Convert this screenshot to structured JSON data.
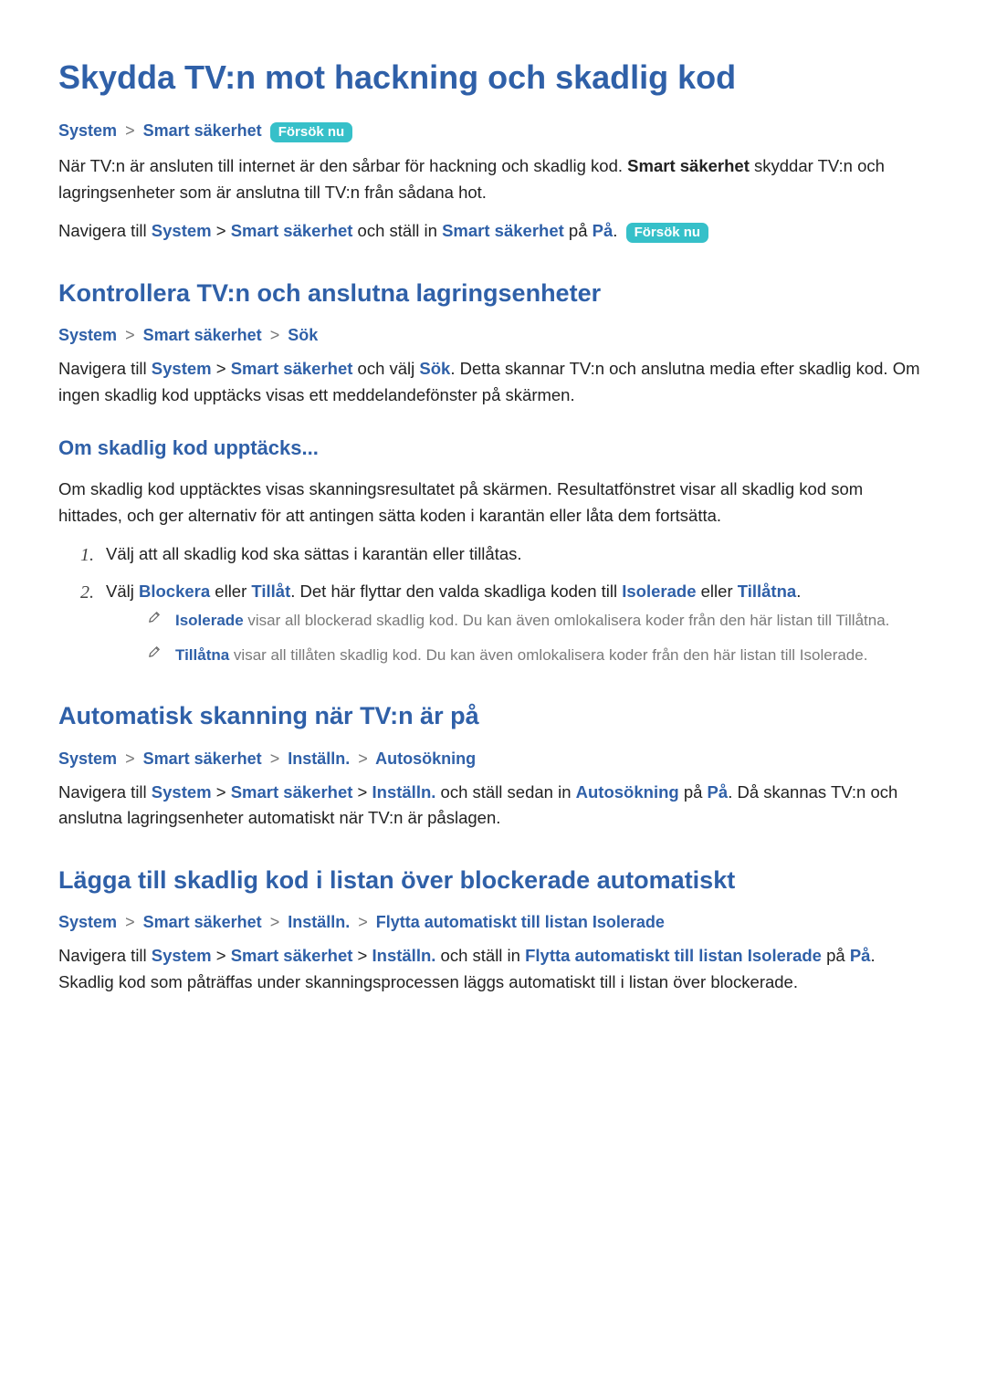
{
  "main_title": "Skydda TV:n mot hackning och skadlig kod",
  "try_now": "Försök nu",
  "intro": {
    "path": {
      "p1": "System",
      "sep": ">",
      "p2": "Smart säkerhet"
    },
    "para1": {
      "t1": "När TV:n är ansluten till internet är den sårbar för hackning och skadlig kod. ",
      "b1": "Smart säkerhet",
      "t2": " skyddar TV:n och lagringsenheter som är anslutna till TV:n från sådana hot."
    },
    "para2": {
      "t1": "Navigera till ",
      "b1": "System",
      "sep": " > ",
      "b2": "Smart säkerhet",
      "t2": " och ställ in ",
      "b3": "Smart säkerhet",
      "t3": " på ",
      "b4": "På",
      "t4": "."
    }
  },
  "sec_check": {
    "title": "Kontrollera TV:n och anslutna lagringsenheter",
    "path": {
      "p1": "System",
      "sep": ">",
      "p2": "Smart säkerhet",
      "p3": "Sök"
    },
    "para1": {
      "t1": "Navigera till ",
      "b1": "System",
      "sep": " > ",
      "b2": "Smart säkerhet",
      "t2": " och välj ",
      "b3": "Sök",
      "t3": ". Detta skannar TV:n och anslutna media efter skadlig kod. Om ingen skadlig kod upptäcks visas ett meddelandefönster på skärmen."
    },
    "sub": {
      "title": "Om skadlig kod upptäcks...",
      "para": "Om skadlig kod upptäcktes visas skanningsresultatet på skärmen. Resultatfönstret visar all skadlig kod som hittades, och ger alternativ för att antingen sätta koden i karantän eller låta dem fortsätta.",
      "step1": "Välj att all skadlig kod ska sättas i karantän eller tillåtas.",
      "step2": {
        "t1": "Välj ",
        "b1": "Blockera",
        "t2": " eller ",
        "b2": "Tillåt",
        "t3": ". Det här flyttar den valda skadliga koden till ",
        "b3": "Isolerade",
        "t4": " eller ",
        "b4": "Tillåtna",
        "t5": "."
      },
      "note1": {
        "b1": "Isolerade",
        "t1": " visar all blockerad skadlig kod. Du kan även omlokalisera koder från den här listan till Tillåtna."
      },
      "note2": {
        "b1": "Tillåtna",
        "t1": " visar all tillåten skadlig kod. Du kan även omlokalisera koder från den här listan till Isolerade."
      }
    }
  },
  "sec_auto": {
    "title": "Automatisk skanning när TV:n är på",
    "path": {
      "p1": "System",
      "p2": "Smart säkerhet",
      "p3": "Inställn.",
      "p4": "Autosökning",
      "sep": ">"
    },
    "para": {
      "t1": "Navigera till ",
      "b1": "System",
      "sep": " > ",
      "b2": "Smart säkerhet",
      "b3": "Inställn.",
      "t2": " och ställ sedan in ",
      "b4": "Autosökning",
      "t3": " på ",
      "b5": "På",
      "t4": ". Då skannas TV:n och anslutna lagringsenheter automatiskt när TV:n är påslagen."
    }
  },
  "sec_block": {
    "title": "Lägga till skadlig kod i listan över blockerade automatiskt",
    "path": {
      "p1": "System",
      "p2": "Smart säkerhet",
      "p3": "Inställn.",
      "p4": "Flytta automatiskt till listan Isolerade",
      "sep": ">"
    },
    "para": {
      "t1": "Navigera till ",
      "b1": "System",
      "b2": "Smart säkerhet",
      "b3": "Inställn.",
      "sep": " > ",
      "t2": " och ställ in ",
      "b4": "Flytta automatiskt till listan Isolerade",
      "t3": " på ",
      "b5": "På",
      "t4": ". Skadlig kod som påträffas under skanningsprocessen läggs automatiskt till i listan över blockerade."
    }
  }
}
